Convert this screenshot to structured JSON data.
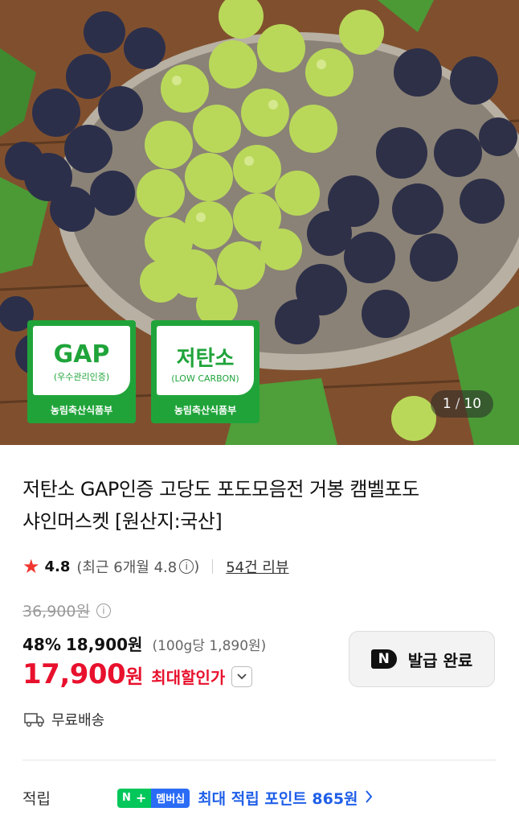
{
  "hero": {
    "image_alt": "grapes",
    "badges": [
      {
        "title": "GAP",
        "subtitle": "(우수관리인증)",
        "footer": "농림축산식품부"
      },
      {
        "title": "저탄소",
        "subtitle": "(LOW CARBON)",
        "footer": "농림축산식품부"
      }
    ],
    "counter_current": "1",
    "counter_sep": "/",
    "counter_total": "10"
  },
  "product": {
    "title_line1": "저탄소 GAP인증 고당도 포도모음전 거봉 캠벨포도",
    "title_line2": "샤인머스켓 [원산지:국산]"
  },
  "rating": {
    "score": "4.8",
    "recent_label": "(최근 6개월 4.8",
    "recent_close": ")",
    "info_glyph": "i",
    "reviews": "54건 리뷰"
  },
  "price": {
    "original": "36,900원",
    "discount_pct": "48%",
    "sale_price": "18,900원",
    "unit_price": "(100g당 1,890원)",
    "max_price_num": "17,900",
    "max_price_won": "원",
    "max_label": "최대할인가"
  },
  "coupon": {
    "logo": "N",
    "label": "발급 완료"
  },
  "shipping": {
    "label": "무료배송"
  },
  "points": {
    "label": "적립",
    "badge_n": "N",
    "badge_plus": "+",
    "badge_text": "멤버십",
    "text": "최대 적립 포인트 865원"
  },
  "colors": {
    "accent_red": "#e8112d",
    "naver_green": "#03c75a",
    "points_blue": "#1f5fe8",
    "badge_green": "#20a43a"
  }
}
